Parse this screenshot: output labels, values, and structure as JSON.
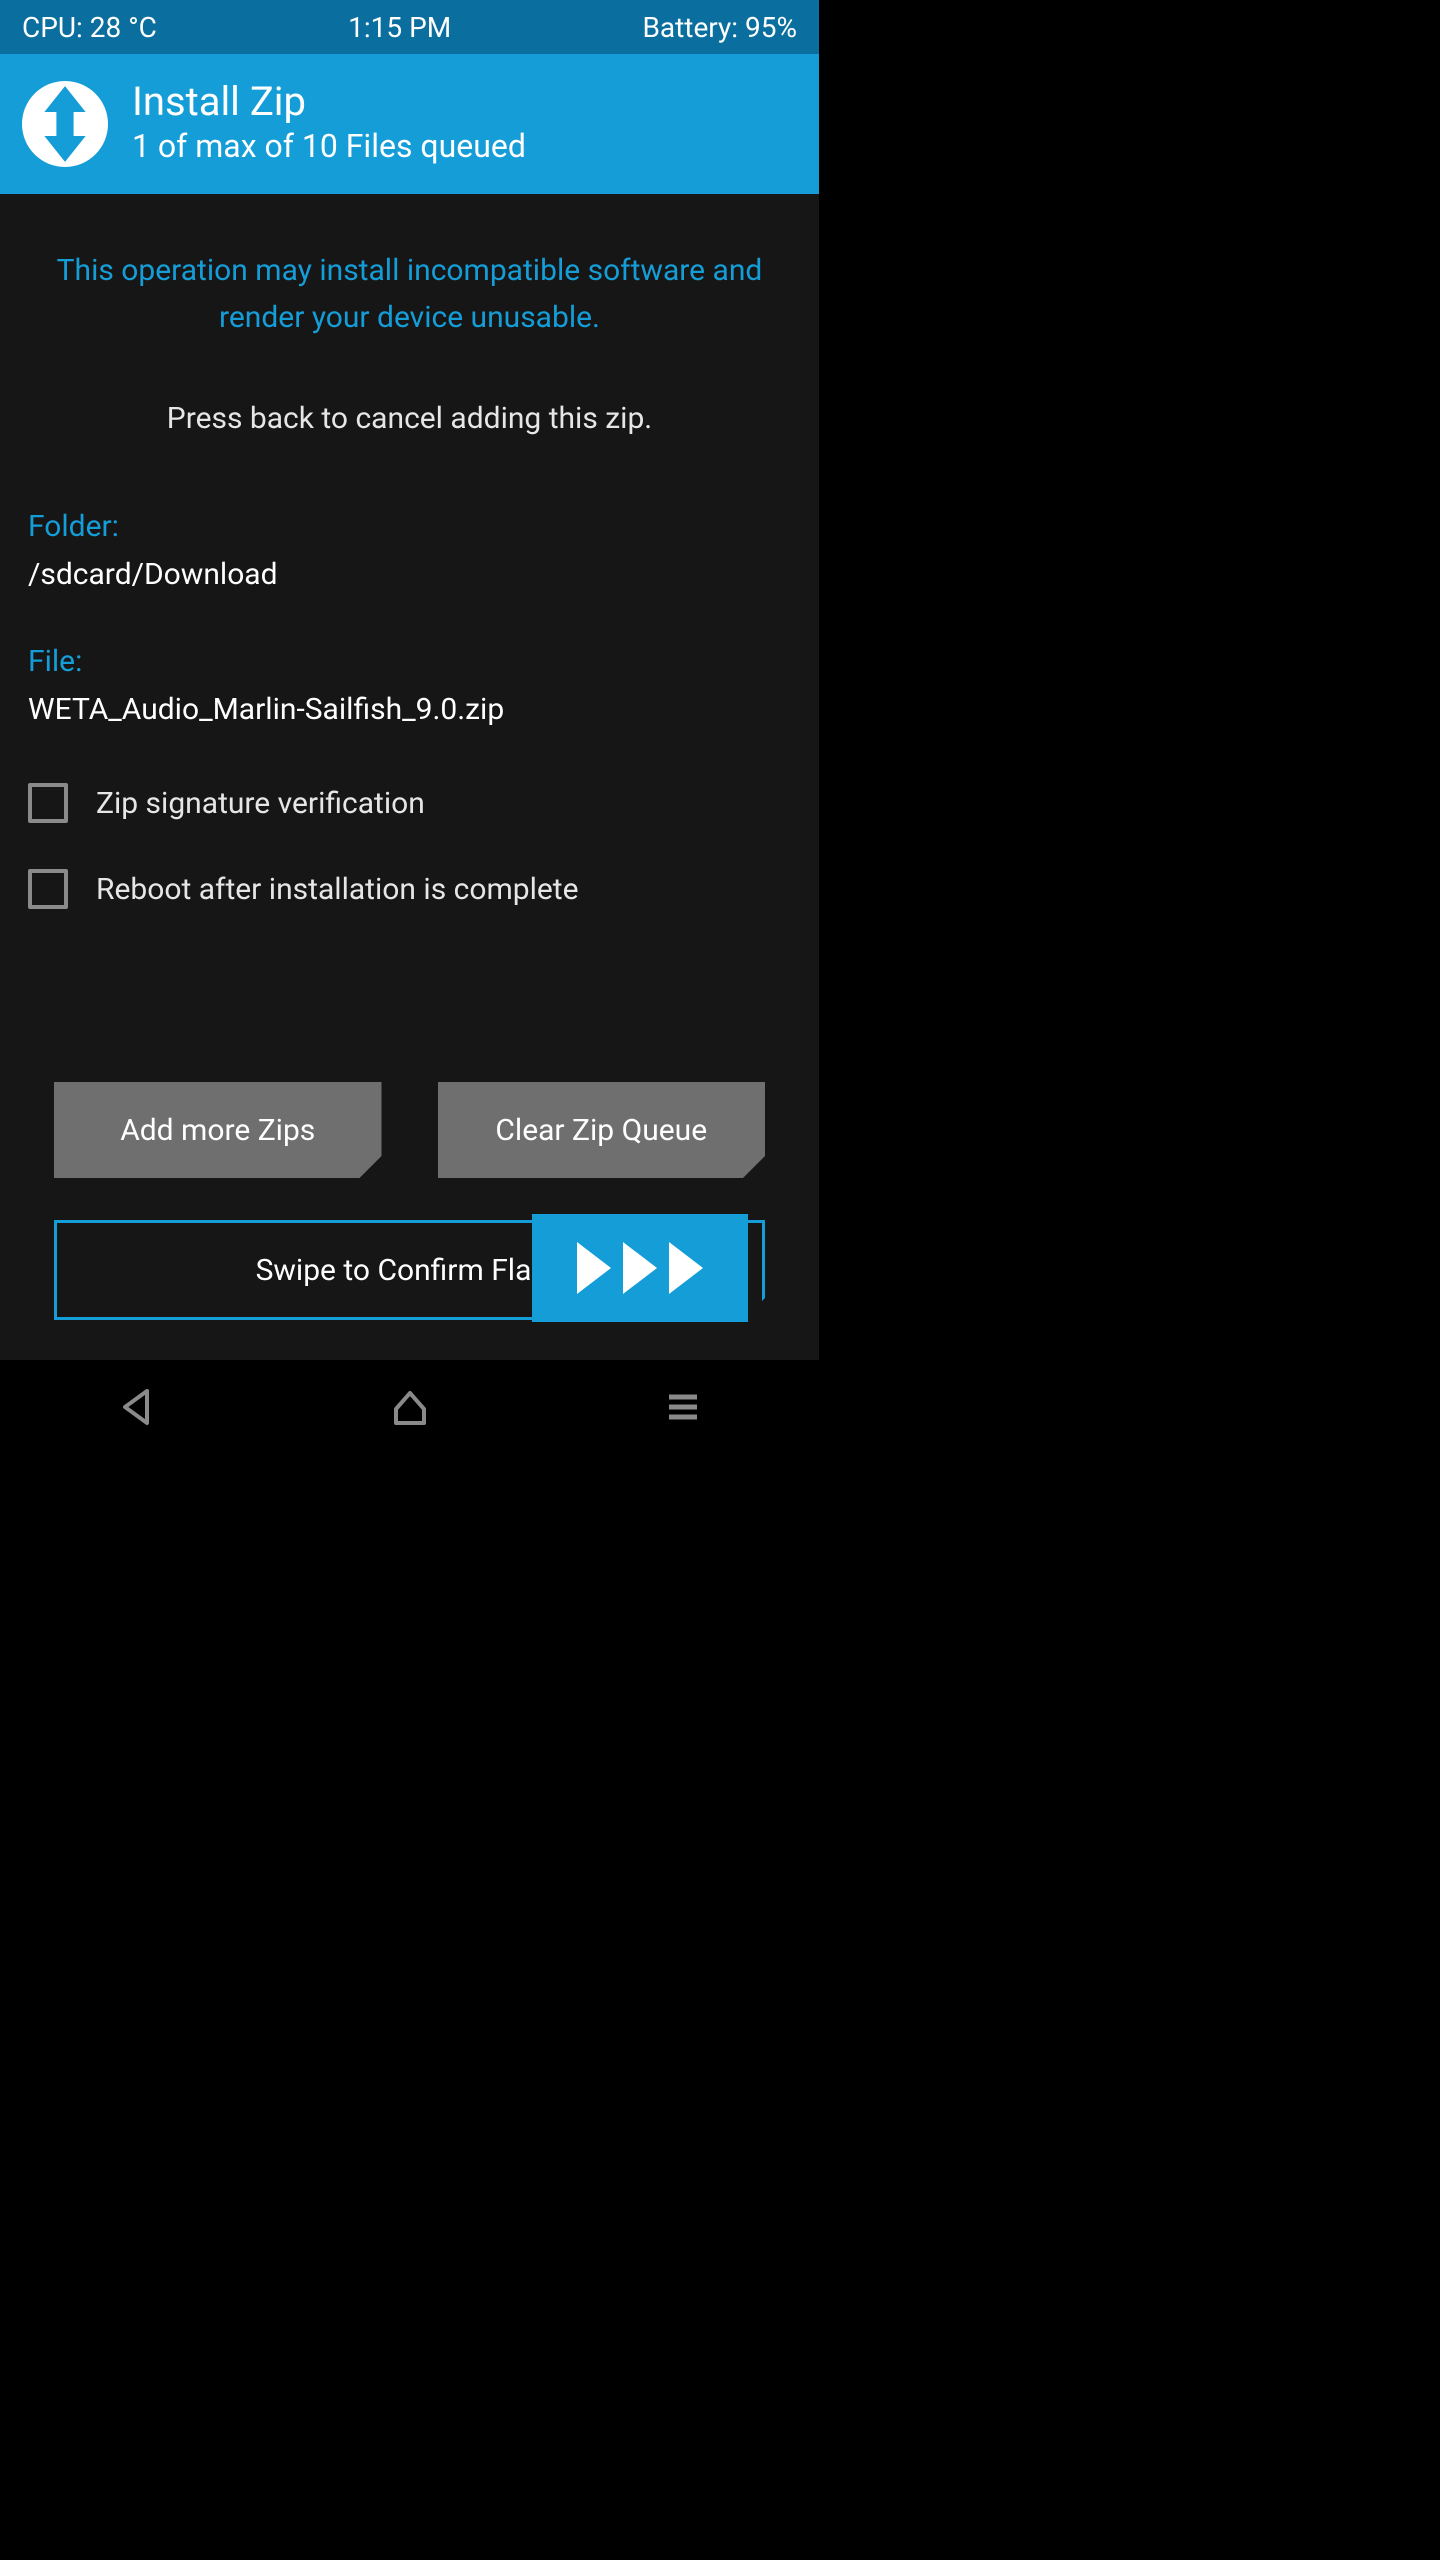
{
  "statusbar": {
    "cpu": "CPU: 28 °C",
    "time": "1:15 PM",
    "battery": "Battery: 95%"
  },
  "header": {
    "title": "Install Zip",
    "subtitle": "1 of max of 10 Files queued"
  },
  "main": {
    "warning": "This operation may install incompatible software and render your device unusable.",
    "cancel_hint": "Press back to cancel adding this zip.",
    "folder_label": "Folder:",
    "folder_value": "/sdcard/Download",
    "file_label": "File:",
    "file_value": "WETA_Audio_Marlin-Sailfish_9.0.zip"
  },
  "checks": {
    "zip_sig": "Zip signature verification",
    "reboot": "Reboot after installation is complete"
  },
  "buttons": {
    "add_more": "Add more Zips",
    "clear_queue": "Clear Zip Queue"
  },
  "slider": {
    "label": "Swipe to Confirm Flash"
  },
  "colors": {
    "accent": "#159dd8",
    "statusbar": "#0a6e9e",
    "button_gray": "#6f6f6f",
    "bg": "#161616"
  }
}
